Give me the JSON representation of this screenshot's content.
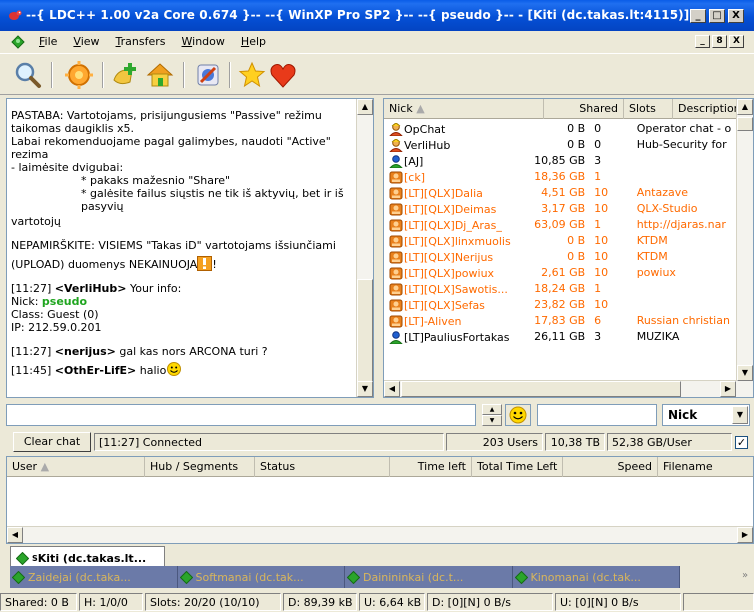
{
  "window": {
    "title": "--{ LDC++ 1.00 v2a Core 0.674 }-- --{ WinXP Pro SP2 }-- --{ pseudo }-- - [Kiti (dc.takas.lt:4115)]",
    "buttons": [
      "_",
      "□",
      "X"
    ],
    "mdi_buttons": [
      "_",
      "8",
      "X"
    ]
  },
  "menu": {
    "file": {
      "acc": "F",
      "rest": "ile"
    },
    "view": {
      "acc": "V",
      "rest": "iew"
    },
    "transfers": {
      "acc": "T",
      "rest": "ransfers"
    },
    "window": {
      "acc": "W",
      "rest": "indow"
    },
    "help": {
      "acc": "H",
      "rest": "elp"
    }
  },
  "toolbar": {
    "icons": [
      "search-icon",
      "spy-icon",
      "add-hub-icon",
      "home-icon",
      "settings-icon",
      "favorites-star-icon",
      "favorites-heart-icon"
    ]
  },
  "chat": {
    "l1": "PASTABA: Vartotojams, prisijungusiems \"Passive\" režimu",
    "l2": "taikomas daugiklis x5.",
    "l3": "Labai rekomenduojame pagal galimybes, naudoti \"Active\" rezima",
    "l4": "- laimėsite dvigubai:",
    "l5": "* pakaks mažesnio \"Share\"",
    "l6": "* galėsite failus siųstis ne tik iš aktyvių, bet ir iš pasyvių",
    "l7": "vartotojų",
    "l8": "NEPAMIRŠKITE: VISIEMS \"Takas iD\" vartotojams išsiunčiami",
    "l9": "(UPLOAD) duomenys NEKAINUOJA",
    "l9end": "!",
    "m1_time": "[11:27] ",
    "m1_nick": "<VerliHub>",
    "m1_text": " Your info:",
    "m1_nick_label": "Nick: ",
    "m1_nick_value": "pseudo",
    "m1_class": "Class: Guest (0)",
    "m1_ip": "IP: 212.59.0.201",
    "m2_time": "[11:27] ",
    "m2_nick": "<nerijus>",
    "m2_text": " gal kas nors  ARCONA turi ?",
    "m3_time": "[11:45] ",
    "m3_nick": "<OthEr-LifE>",
    "m3_text": " halio"
  },
  "users": {
    "columns": {
      "nick": "Nick",
      "shared": "Shared",
      "slots": "Slots",
      "description": "Description"
    },
    "rows": [
      {
        "nick": "OpChat",
        "shared": "0 B",
        "slots": "0",
        "desc": "Operator chat - o",
        "color": "#000000",
        "icon": "operator-icon"
      },
      {
        "nick": "VerliHub",
        "shared": "0 B",
        "slots": "0",
        "desc": "Hub-Security for",
        "color": "#000000",
        "icon": "operator-icon"
      },
      {
        "nick": "[AJ]",
        "shared": "10,85 GB",
        "slots": "3",
        "desc": "",
        "color": "#000000",
        "icon": "user-icon"
      },
      {
        "nick": "[ck]",
        "shared": "18,36 GB",
        "slots": "1",
        "desc": "",
        "color": "#ff6a00",
        "icon": "passive-user-icon"
      },
      {
        "nick": "[LT][QLX]Dalia",
        "shared": "4,51 GB",
        "slots": "10",
        "desc": "Antazave",
        "color": "#ff6a00",
        "icon": "passive-user-icon"
      },
      {
        "nick": "[LT][QLX]Deimas",
        "shared": "3,17 GB",
        "slots": "10",
        "desc": "QLX-Studio",
        "color": "#ff6a00",
        "icon": "passive-user-icon"
      },
      {
        "nick": "[LT][QLX]Dj_Aras_",
        "shared": "63,09 GB",
        "slots": "1",
        "desc": "http://djaras.nar",
        "color": "#ff6a00",
        "icon": "passive-user-icon"
      },
      {
        "nick": "[LT][QLX]linxmuolis",
        "shared": "0 B",
        "slots": "10",
        "desc": "KTDM",
        "color": "#ff6a00",
        "icon": "passive-user-icon"
      },
      {
        "nick": "[LT][QLX]Nerijus",
        "shared": "0 B",
        "slots": "10",
        "desc": "KTDM",
        "color": "#ff6a00",
        "icon": "passive-user-icon"
      },
      {
        "nick": "[LT][QLX]powiux",
        "shared": "2,61 GB",
        "slots": "10",
        "desc": "powiux",
        "color": "#ff6a00",
        "icon": "passive-user-icon"
      },
      {
        "nick": "[LT][QLX]Sawotis...",
        "shared": "18,24 GB",
        "slots": "1",
        "desc": "",
        "color": "#ff6a00",
        "icon": "passive-user-icon"
      },
      {
        "nick": "[LT][QLX]Sefas",
        "shared": "23,82 GB",
        "slots": "10",
        "desc": "",
        "color": "#ff6a00",
        "icon": "passive-user-icon"
      },
      {
        "nick": "[LT]-Aliven",
        "shared": "17,83 GB",
        "slots": "6",
        "desc": "Russian christian",
        "color": "#ff6a00",
        "icon": "passive-user-icon"
      },
      {
        "nick": "[LT]PauliusFortakas",
        "shared": "26,11 GB",
        "slots": "3",
        "desc": "MUZIKA",
        "color": "#000000",
        "icon": "user-icon"
      }
    ]
  },
  "filter": {
    "column": "Nick"
  },
  "status": {
    "clear_chat": "Clear chat",
    "connected": "[11:27] Connected",
    "users": "203 Users",
    "total_share": "10,38 TB",
    "per_user": "52,38 GB/User",
    "checked": "✓"
  },
  "transfers": {
    "columns": {
      "user": "User",
      "hub": "Hub / Segments",
      "status": "Status",
      "time_left": "Time left",
      "total_time_left": "Total Time Left",
      "speed": "Speed",
      "filename": "Filename"
    }
  },
  "hub_tabs": {
    "active": {
      "prefix": "S",
      "label": "Kiti (dc.takas.lt..."
    },
    "others": [
      {
        "label": "Zaidejai (dc.taka..."
      },
      {
        "label": "Softmanai (dc.tak..."
      },
      {
        "label": "Dainininkai (dc.t..."
      },
      {
        "label": "Kinomanai (dc.tak..."
      }
    ],
    "more": "»"
  },
  "statusbar": {
    "shared": "Shared: 0 B",
    "hubs": "H: 1/0/0",
    "slots": "Slots: 20/20 (10/10)",
    "down": "D: 89,39 kB",
    "up": "U: 6,64 kB",
    "down_rate": "D: [0][N] 0 B/s",
    "up_rate": "U: [0][N] 0 B/s"
  },
  "colors": {
    "title_bar": "#0550d6",
    "passive_user": "#ff6a00",
    "pseudo_nick": "#1fa51f",
    "inactive_tab": "#6b7aa8",
    "inactive_tab_text": "#d9b65c"
  }
}
